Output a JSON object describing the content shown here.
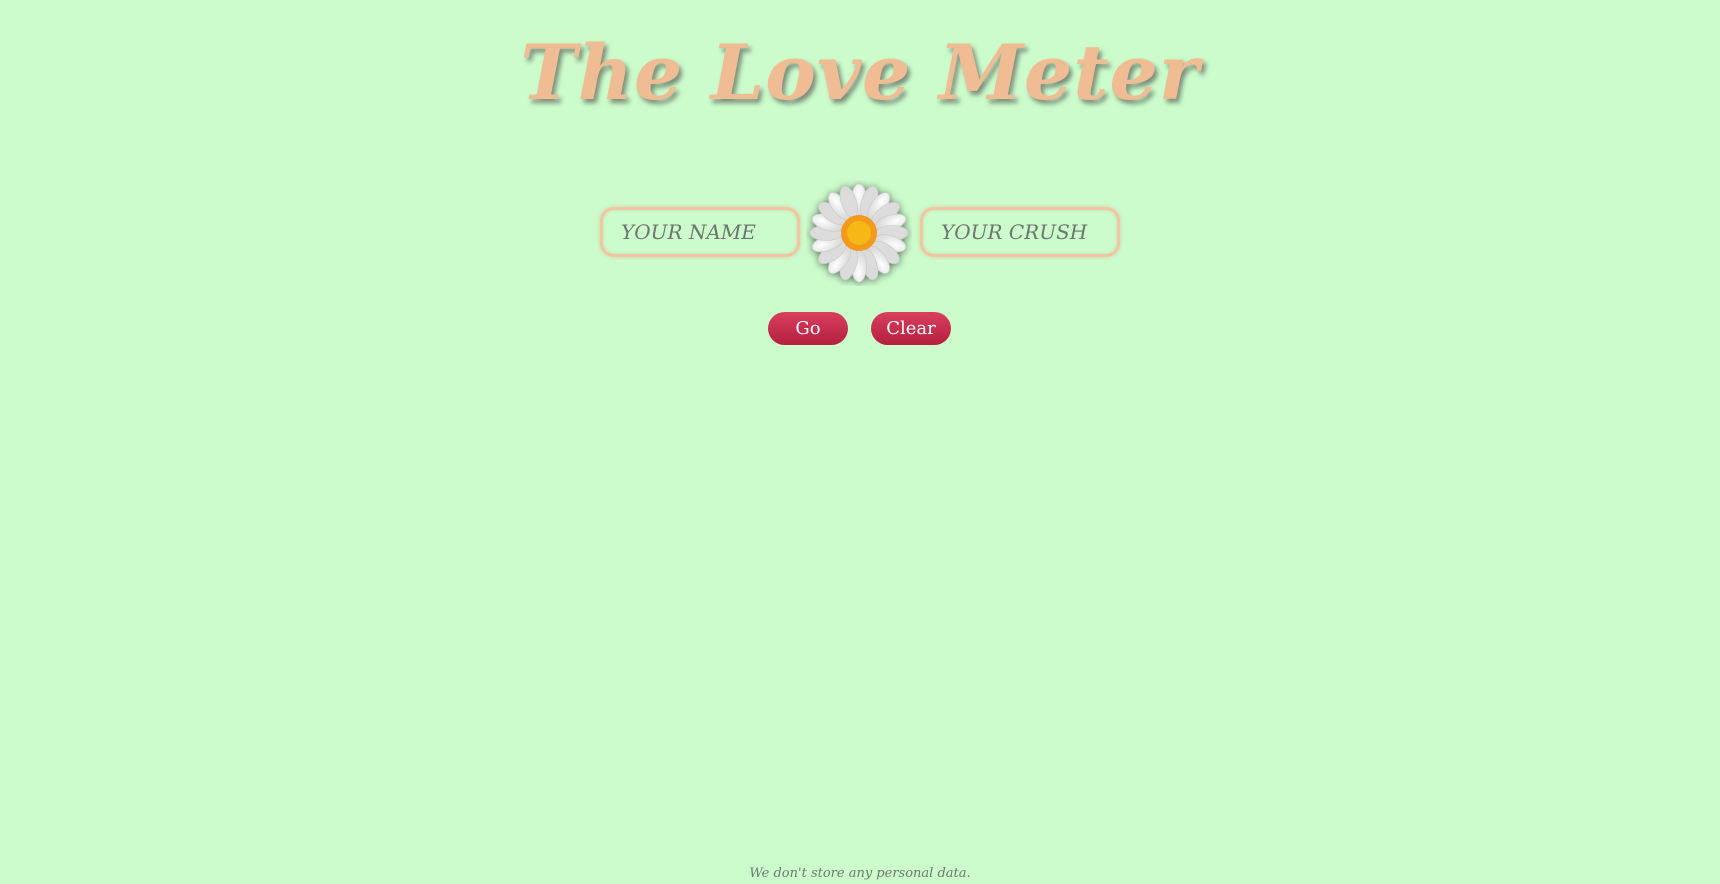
{
  "header": {
    "title": "The Love Meter"
  },
  "form": {
    "name_placeholder": "YOUR NAME",
    "name_value": "",
    "crush_placeholder": "YOUR CRUSH",
    "crush_value": "",
    "center_icon": "daisy-icon"
  },
  "actions": {
    "go_label": "Go",
    "clear_label": "Clear"
  },
  "footer": {
    "privacy_note": "We don't store any personal data."
  },
  "colors": {
    "background": "#ccfccc",
    "title": "#f0bc93",
    "field_border": "#f2c6a0",
    "button": "#c9304f",
    "button_text": "#ffffff",
    "daisy_petal": "#f3f3f3",
    "daisy_center": "#f5b818"
  }
}
